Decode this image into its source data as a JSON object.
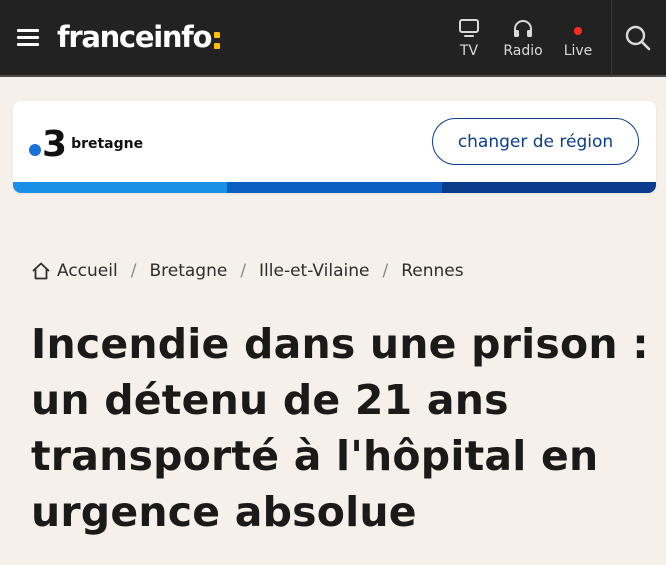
{
  "header": {
    "logo_text": "franceinfo",
    "nav": [
      {
        "label": "TV",
        "icon": "tv-icon"
      },
      {
        "label": "Radio",
        "icon": "headphones-icon"
      },
      {
        "label": "Live",
        "icon": "live-dot-icon"
      }
    ],
    "search_icon": "search-icon",
    "menu_icon": "hamburger-menu-icon"
  },
  "region": {
    "channel_number": "3",
    "name": "bretagne",
    "change_button": "changer de région",
    "bar_colors": [
      "#1a8fe8",
      "#0b5fc0",
      "#0b3d8c"
    ]
  },
  "breadcrumb": {
    "items": [
      "Accueil",
      "Bretagne",
      "Ille-et-Vilaine",
      "Rennes"
    ],
    "separator": "/"
  },
  "article": {
    "title": "Incendie dans une prison : un détenu de 21 ans transporté à l'hôpital en urgence absolue"
  },
  "colors": {
    "header_bg": "#222222",
    "page_bg": "#f5f1ea",
    "accent_yellow": "#ffbf00",
    "live_red": "#ff2a1f",
    "region_blue": "#0b3d8c"
  }
}
